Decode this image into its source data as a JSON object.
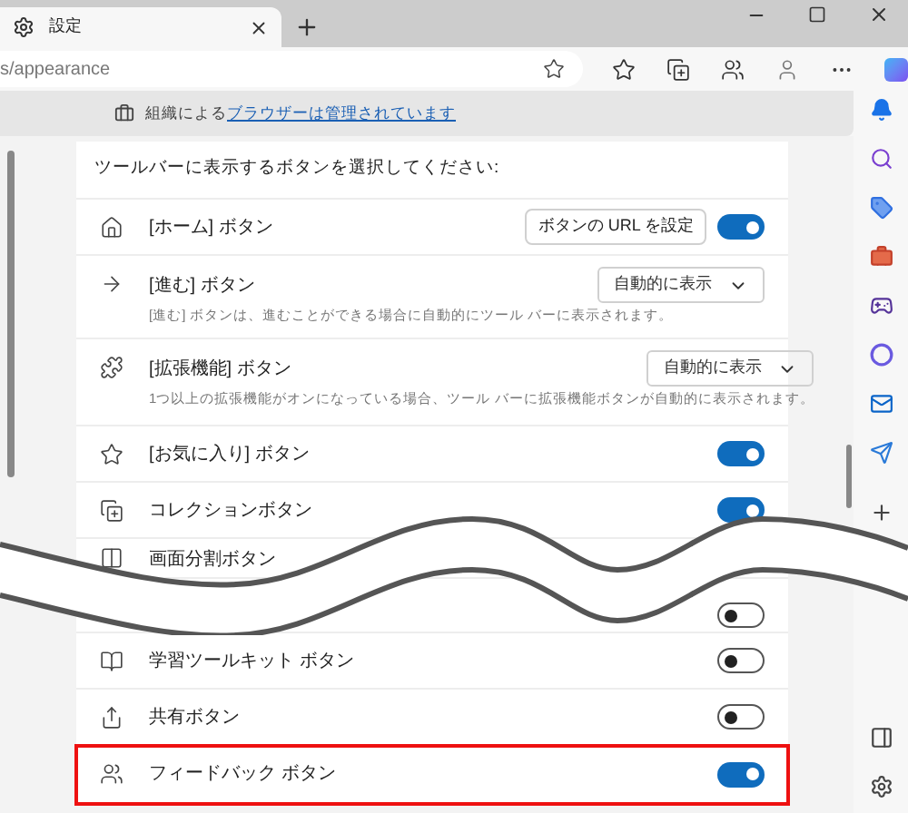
{
  "tab": {
    "title": "設定"
  },
  "address": {
    "value": "s/appearance"
  },
  "managed_notice": {
    "prefix": "組織による",
    "link": "ブラウザーは管理されています"
  },
  "section": {
    "heading": "ツールバーに表示するボタンを選択してください:"
  },
  "rows": [
    {
      "kind": "toggle_button",
      "label": "[ホーム] ボタン",
      "button": "ボタンの URL を設定",
      "on": true,
      "highlighted": false
    },
    {
      "kind": "dropdown",
      "label": "[進む] ボタン",
      "description": "[進む] ボタンは、進むことができる場合に自動的にツール バーに表示されます。",
      "value": "自動的に表示",
      "highlighted": false
    },
    {
      "kind": "dropdown",
      "label": "[拡張機能] ボタン",
      "description": "1つ以上の拡張機能がオンになっている場合、ツール バーに拡張機能ボタンが自動的に表示されます。",
      "value": "自動的に表示",
      "highlighted": false
    },
    {
      "kind": "toggle",
      "label": "[お気に入り] ボタン",
      "on": true,
      "highlighted": false
    },
    {
      "kind": "toggle",
      "label": "コレクションボタン",
      "on": true,
      "highlighted": false
    },
    {
      "kind": "label",
      "label": "画面分割ボタン",
      "highlighted": false
    },
    {
      "kind": "toggle",
      "on": false,
      "highlighted": false
    },
    {
      "kind": "toggle",
      "label": "学習ツールキット ボタン",
      "on": false,
      "highlighted": false
    },
    {
      "kind": "toggle",
      "label": "共有ボタン",
      "on": false,
      "highlighted": false
    },
    {
      "kind": "toggle",
      "label": "フィードバック ボタン",
      "on": true,
      "highlighted": true
    }
  ]
}
